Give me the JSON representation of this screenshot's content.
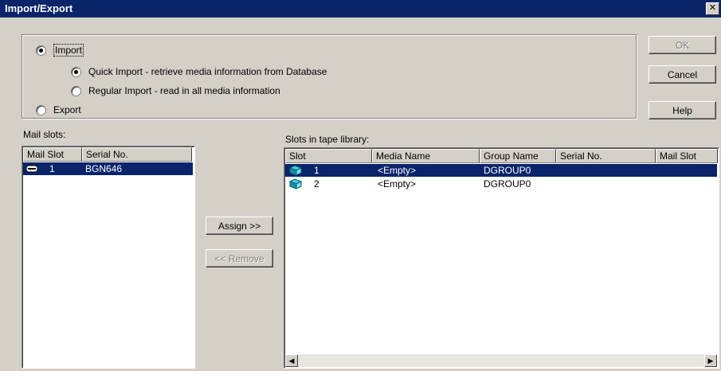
{
  "window": {
    "title": "Import/Export",
    "close_glyph": "✕"
  },
  "options": {
    "import_label": "Import",
    "quick_import_label": "Quick Import - retrieve media information from Database",
    "regular_import_label": "Regular Import - read in all media information",
    "export_label": "Export",
    "selected": "import",
    "import_mode": "quick"
  },
  "buttons": {
    "ok": "OK",
    "cancel": "Cancel",
    "help": "Help",
    "assign": "Assign >>",
    "remove": "<< Remove"
  },
  "mail_slots": {
    "label": "Mail slots:",
    "columns": [
      "Mail Slot",
      "Serial No."
    ],
    "rows": [
      {
        "slot": "1",
        "serial": "BGN646",
        "icon": "tape-cartridge-icon"
      }
    ]
  },
  "tape_library": {
    "label": "Slots in tape library:",
    "columns": [
      "Slot",
      "Media Name",
      "Group Name",
      "Serial No.",
      "Mail Slot"
    ],
    "rows": [
      {
        "slot": "1",
        "media": "<Empty>",
        "group": "DGROUP0",
        "serial": "",
        "mail_slot": "",
        "icon": "tape-slot-icon"
      },
      {
        "slot": "2",
        "media": "<Empty>",
        "group": "DGROUP0",
        "serial": "",
        "mail_slot": "",
        "icon": "tape-slot-icon"
      }
    ]
  },
  "colors": {
    "titlebar": "#0a246a",
    "selection": "#0a246a",
    "dialog_bg": "#d4d0c8"
  }
}
